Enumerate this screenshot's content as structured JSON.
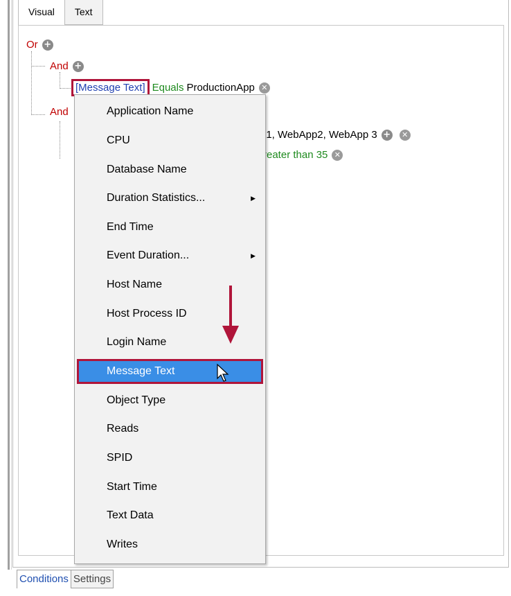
{
  "tabs_top": [
    {
      "label": "Visual",
      "active": true
    },
    {
      "label": "Text",
      "active": false
    }
  ],
  "tree": {
    "root_op": "Or",
    "and1": "And",
    "cond1_field": "[Message Text]",
    "cond1_op": "Equals",
    "cond1_value": "ProductionApp",
    "and2": "And",
    "cond2_partial": "p1, WebApp2, WebApp 3",
    "cond3_partial": "reater than 35"
  },
  "menu": {
    "items": [
      {
        "label": "Application Name",
        "submenu": false
      },
      {
        "label": "CPU",
        "submenu": false
      },
      {
        "label": "Database Name",
        "submenu": false
      },
      {
        "label": "Duration Statistics...",
        "submenu": true
      },
      {
        "label": "End Time",
        "submenu": false
      },
      {
        "label": "Event Duration...",
        "submenu": true
      },
      {
        "label": "Host Name",
        "submenu": false
      },
      {
        "label": "Host Process ID",
        "submenu": false
      },
      {
        "label": "Login Name",
        "submenu": false
      },
      {
        "label": "Message Text",
        "submenu": false,
        "highlighted": true
      },
      {
        "label": "Object Type",
        "submenu": false
      },
      {
        "label": "Reads",
        "submenu": false
      },
      {
        "label": "SPID",
        "submenu": false
      },
      {
        "label": "Start Time",
        "submenu": false
      },
      {
        "label": "Text Data",
        "submenu": false
      },
      {
        "label": "Writes",
        "submenu": false
      }
    ]
  },
  "bottom_tabs": [
    {
      "label": "Conditions",
      "active": true
    },
    {
      "label": "Settings",
      "active": false
    }
  ],
  "colors": {
    "highlight": "#3a8ee6",
    "annotation_red": "#b0153a",
    "operator_red": "#c00000",
    "field_blue": "#1f3fb0",
    "operator_green": "#1e8a1e"
  },
  "icons": {
    "add": "plus-circle-icon",
    "remove": "x-circle-icon",
    "cursor": "mouse-pointer-icon",
    "annotation": "down-arrow-icon",
    "submenu": "triangle-right-icon"
  }
}
